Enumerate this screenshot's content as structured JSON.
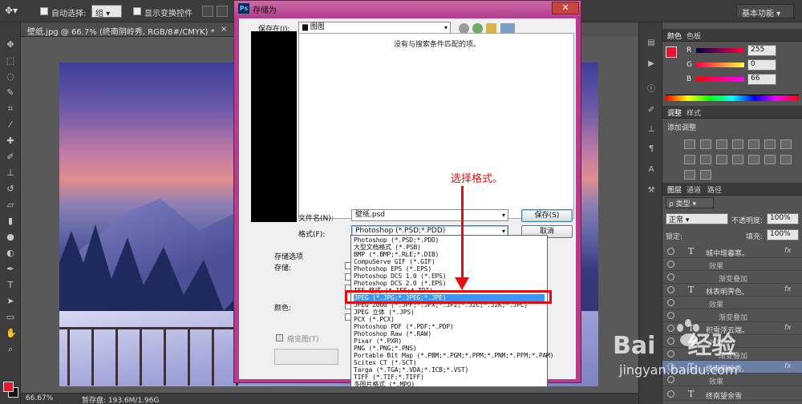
{
  "options_bar": {
    "auto_select_label": "自动选择:",
    "auto_select_value": "组",
    "show_transform_label": "显示变换控件",
    "workspace": "基本功能"
  },
  "document": {
    "tab_title": "壁纸.jpg @ 66.7% (终南阴岭秀, RGB/8#/CMYK) *",
    "close": "×"
  },
  "status_bar": {
    "zoom": "66.67%",
    "scratch": "暂存盘: 193.6M/1.96G"
  },
  "color_panel": {
    "tabs": [
      "颜色",
      "色板"
    ],
    "channels": [
      {
        "name": "R",
        "value": "255"
      },
      {
        "name": "G",
        "value": "0"
      },
      {
        "name": "B",
        "value": "66"
      }
    ],
    "colors": {
      "foreground": "#e8152f"
    }
  },
  "adjustments_panel": {
    "tabs": [
      "调整",
      "样式"
    ],
    "title": "添加调整"
  },
  "layers_panel": {
    "tabs": [
      "图层",
      "通道",
      "路径"
    ],
    "kind_filter": "类型",
    "blend_mode": "正常",
    "opacity_label": "不透明度:",
    "opacity_value": "100%",
    "lock_label": "锁定:",
    "fill_label": "填充:",
    "fill_value": "100%",
    "layers": [
      {
        "name": "城中增暮寒。",
        "type": "T",
        "fx": "fx"
      },
      {
        "name": "效果",
        "sub": true
      },
      {
        "name": "渐变叠加",
        "sub": true
      },
      {
        "name": "林表明霁色,",
        "type": "T",
        "fx": "fx"
      },
      {
        "name": "效果",
        "sub": true
      },
      {
        "name": "渐变叠加",
        "sub": true
      },
      {
        "name": "积雪浮云端。",
        "type": "T",
        "fx": "fx"
      },
      {
        "name": "效果",
        "sub": true
      },
      {
        "name": "渐变叠加",
        "sub": true
      },
      {
        "name": "终南阴岭秀,",
        "type": "T",
        "fx": "fx",
        "selected": true
      },
      {
        "name": "效果",
        "sub": true
      },
      {
        "name": "终南望余雪",
        "type": "T"
      }
    ]
  },
  "save_dialog": {
    "title": "存储为",
    "close": "✕",
    "save_in_label": "保存在(I):",
    "save_in_value": "图图",
    "empty_message": "没有与搜索条件匹配的项。",
    "filename_label": "文件名(N):",
    "filename_value": "壁纸.psd",
    "format_label": "格式(F):",
    "format_value": "Photoshop (*.PSD;*.PDD)",
    "save_button": "保存(S)",
    "cancel_button": "取消",
    "options_label": "存储选项",
    "save_label": "存储:",
    "color_label": "颜色:",
    "thumbnail_label": "缩览图(T)",
    "format_options": [
      "Photoshop (*.PSD;*.PDD)",
      "大型文档格式 (*.PSB)",
      "BMP (*.BMP;*.RLE;*.DIB)",
      "CompuServe GIF (*.GIF)",
      "Photoshop EPS (*.EPS)",
      "Photoshop DCS 1.0 (*.EPS)",
      "Photoshop DCS 2.0 (*.EPS)",
      "IFF 格式 (*.IFF;*.TDI)",
      "JPEG (*.JPG;*.JPEG;*.JPE)",
      "JPEG 2000 (*.JPF;*.JPX;*.JP2;*.J2C;*.J2K;*.JPC)",
      "JPEG 立体 (*.JPS)",
      "PCX (*.PCX)",
      "Photoshop PDF (*.PDF;*.PDP)",
      "Photoshop Raw (*.RAW)",
      "Pixar (*.PXR)",
      "PNG (*.PNG;*.PNS)",
      "Portable Bit Map (*.PBM;*.PGM;*.PPM;*.PNM;*.PFM;*.PAM)",
      "Scitex CT (*.SCT)",
      "Targa (*.TGA;*.VDA;*.ICB;*.VST)",
      "TIFF (*.TIF;*.TIFF)",
      "多图片格式 (*.MPO)"
    ],
    "highlighted_index": 8
  },
  "annotation": {
    "text": "选择格式。",
    "color": "#e01010"
  },
  "watermark": {
    "brand": "Bai",
    "brand_suffix": "经验",
    "url": "jingyan.baidu.com"
  }
}
